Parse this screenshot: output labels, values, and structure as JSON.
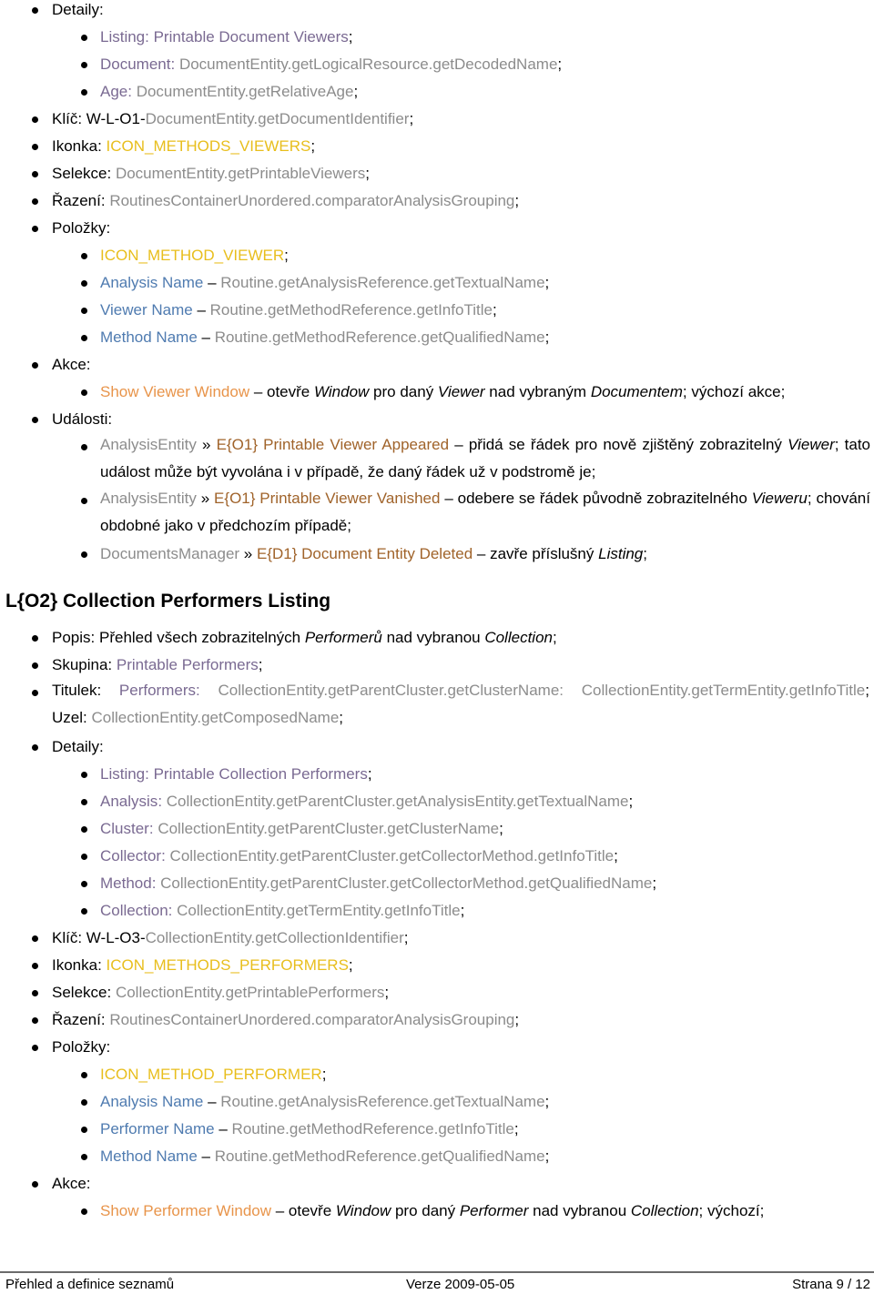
{
  "colors": {
    "label": "#7a6a92",
    "code": "#8c8c8c",
    "icon": "#e8be1c",
    "column": "#4f7bb0",
    "action": "#e8944a",
    "event": "#a0632a"
  },
  "section1": {
    "detaily_label": "Detaily:",
    "details": [
      {
        "label": "Listing: Printable Document Viewers",
        "value": "",
        "sep": "",
        "end": ";"
      },
      {
        "label": "Document",
        "sep": ": ",
        "value": "DocumentEntity.getLogicalResource.getDecodedName",
        "end": ";"
      },
      {
        "label": "Age",
        "sep": ": ",
        "value": "DocumentEntity.getRelativeAge",
        "end": ";"
      }
    ],
    "klic_label": "Klíč: ",
    "klic_prefix": "W-L-O1-",
    "klic_value": "DocumentEntity.getDocumentIdentifier",
    "ikonka_label": "Ikonka: ",
    "ikonka_value": "ICON_METHODS_VIEWERS",
    "selekce_label": "Selekce: ",
    "selekce_value": "DocumentEntity.getPrintableViewers",
    "razeni_label": "Řazení: ",
    "razeni_value": "RoutinesContainerUnordered.comparatorAnalysisGrouping",
    "polozky_label": "Položky:",
    "items": [
      {
        "name": "ICON_METHOD_VIEWER",
        "expr": ""
      },
      {
        "name": "Analysis Name",
        "expr": "Routine.getAnalysisReference.getTextualName"
      },
      {
        "name": "Viewer Name",
        "expr": "Routine.getMethodReference.getInfoTitle"
      },
      {
        "name": "Method Name",
        "expr": "Routine.getMethodReference.getQualifiedName"
      }
    ],
    "akce_label": "Akce:",
    "action": {
      "name": "Show Viewer Window",
      "dash": " – ",
      "t1": "otevře ",
      "i1": "Window",
      "t2": " pro daný ",
      "i2": "Viewer",
      "t3": " nad vybraným ",
      "i3": "Documentem",
      "t4": "; výchozí akce;"
    },
    "udalosti_label": "Události:",
    "events": [
      {
        "source": "AnalysisEntity",
        "arrow": " » ",
        "name": "E{O1} Printable Viewer Appeared",
        "desc1": " – přidá se řádek pro nově zjištěný zobrazitelný ",
        "italic": "Viewer",
        "desc2": "; tato událost může být vyvolána i v případě, že daný řádek už v podstromě je;"
      },
      {
        "source": "AnalysisEntity",
        "arrow": " » ",
        "name": "E{O1} Printable Viewer Vanished",
        "desc1": " – odebere se řádek původně zobrazitelného ",
        "italic": "Vieweru",
        "desc2": "; chování obdobné jako v předchozím případě;"
      },
      {
        "source": "DocumentsManager",
        "arrow": " » ",
        "name": "E{D1} Document Entity Deleted",
        "desc1": " – zavře příslušný ",
        "italic": "Listing",
        "desc2": ";"
      }
    ]
  },
  "section2": {
    "heading": "L{O2} Collection Performers Listing",
    "popis_label": "Popis: ",
    "popis_t1": "Přehled všech zobrazitelných ",
    "popis_i1": "Performerů",
    "popis_t2": " nad vybranou ",
    "popis_i2": "Collection",
    "popis_end": ";",
    "skupina_label": "Skupina: ",
    "skupina_value": "Printable Performers",
    "titulek_label": "Titulek: ",
    "titulek_p1": "Performers: ",
    "titulek_c1": "CollectionEntity.getParentCluster.getClusterName: ",
    "titulek_c2": "CollectionEntity.getTermEntity.",
    "titulek_c3": "getInfoTitle",
    "uzel_label": "; Uzel: ",
    "uzel_value": "CollectionEntity.getComposedName",
    "detaily_label": "Detaily:",
    "details": [
      {
        "label": "Listing: Printable Collection Performers",
        "sep": "",
        "value": ""
      },
      {
        "label": "Analysis",
        "sep": ": ",
        "value": "CollectionEntity.getParentCluster.getAnalysisEntity.getTextualName"
      },
      {
        "label": "Cluster",
        "sep": ": ",
        "value": "CollectionEntity.getParentCluster.getClusterName"
      },
      {
        "label": "Collector",
        "sep": ": ",
        "value": "CollectionEntity.getParentCluster.getCollectorMethod.getInfoTitle"
      },
      {
        "label": "Method",
        "sep": ": ",
        "value": "CollectionEntity.getParentCluster.getCollectorMethod.getQualifiedName"
      },
      {
        "label": "Collection",
        "sep": ": ",
        "value": "CollectionEntity.getTermEntity.getInfoTitle"
      }
    ],
    "klic_label": "Klíč: ",
    "klic_prefix": "W-L-O3-",
    "klic_value": "CollectionEntity.getCollectionIdentifier",
    "ikonka_label": "Ikonka: ",
    "ikonka_value": "ICON_METHODS_PERFORMERS",
    "selekce_label": "Selekce: ",
    "selekce_value": "CollectionEntity.getPrintablePerformers",
    "razeni_label": "Řazení: ",
    "razeni_value": "RoutinesContainerUnordered.comparatorAnalysisGrouping",
    "polozky_label": "Položky:",
    "items": [
      {
        "name": "ICON_METHOD_PERFORMER",
        "expr": ""
      },
      {
        "name": "Analysis Name",
        "expr": "Routine.getAnalysisReference.getTextualName"
      },
      {
        "name": "Performer Name",
        "expr": "Routine.getMethodReference.getInfoTitle"
      },
      {
        "name": "Method Name",
        "expr": "Routine.getMethodReference.getQualifiedName"
      }
    ],
    "akce_label": "Akce:",
    "action": {
      "name": "Show Performer Window",
      "dash": " – ",
      "t1": "otevře ",
      "i1": "Window",
      "t2": " pro daný ",
      "i2": "Performer",
      "t3": " nad vybranou ",
      "i3": "Collection",
      "t4": "; výchozí;"
    }
  },
  "footer": {
    "left": "Přehled a definice seznamů",
    "center": "Verze 2009-05-05",
    "right": "Strana 9 / 12"
  },
  "punct": {
    "semicolon": ";",
    "dash": " – "
  }
}
